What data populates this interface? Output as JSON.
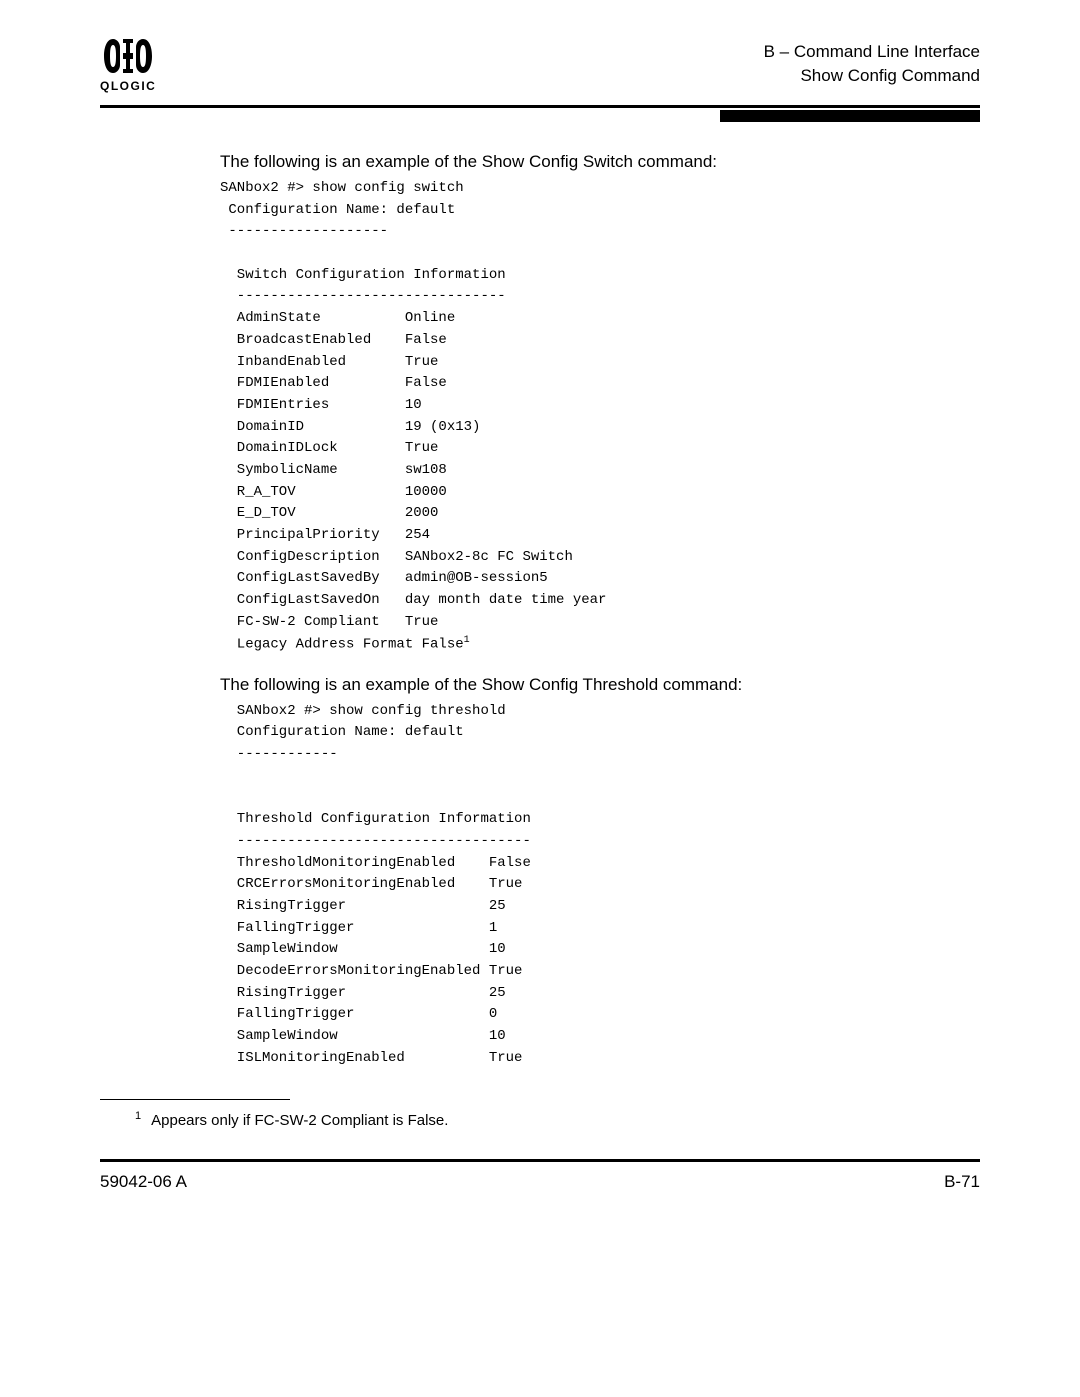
{
  "header": {
    "logoText": "QLOGIC",
    "line1": "B – Command Line Interface",
    "line2": "Show Config Command"
  },
  "section1": {
    "intro": "The following is an example of the Show Config Switch command:",
    "prompt": "SANbox2 #> show config switch",
    "confName": " Configuration Name: default",
    "dash1": " -------------------",
    "title": "  Switch Configuration Information",
    "dash2": "  --------------------------------",
    "rows": [
      {
        "k": "  AdminState          ",
        "v": "Online"
      },
      {
        "k": "  BroadcastEnabled    ",
        "v": "False"
      },
      {
        "k": "  InbandEnabled       ",
        "v": "True"
      },
      {
        "k": "  FDMIEnabled         ",
        "v": "False"
      },
      {
        "k": "  FDMIEntries         ",
        "v": "10"
      },
      {
        "k": "  DomainID            ",
        "v": "19 (0x13)"
      },
      {
        "k": "  DomainIDLock        ",
        "v": "True"
      },
      {
        "k": "  SymbolicName        ",
        "v": "sw108"
      },
      {
        "k": "  R_A_TOV             ",
        "v": "10000"
      },
      {
        "k": "  E_D_TOV             ",
        "v": "2000"
      },
      {
        "k": "  PrincipalPriority   ",
        "v": "254"
      },
      {
        "k": "  ConfigDescription   ",
        "v": "SANbox2-8c FC Switch"
      },
      {
        "k": "  ConfigLastSavedBy   ",
        "v": "admin@OB-session5"
      },
      {
        "k": "  ConfigLastSavedOn   ",
        "v": "day month date time year"
      },
      {
        "k": "  FC-SW-2 Compliant   ",
        "v": "True"
      }
    ],
    "lastRowKey": "  Legacy Address Format ",
    "lastRowVal": "False",
    "lastRowSup": "1"
  },
  "section2": {
    "intro": "The following is an example of the Show Config Threshold command:",
    "prompt": "  SANbox2 #> show config threshold",
    "confName": "  Configuration Name: default",
    "dash1": "  ------------",
    "title": "  Threshold Configuration Information",
    "dash2": "  -----------------------------------",
    "rows": [
      {
        "k": "  ThresholdMonitoringEnabled    ",
        "v": "False"
      },
      {
        "k": "  CRCErrorsMonitoringEnabled    ",
        "v": "True"
      },
      {
        "k": "  RisingTrigger                 ",
        "v": "25"
      },
      {
        "k": "  FallingTrigger                ",
        "v": "1"
      },
      {
        "k": "  SampleWindow                  ",
        "v": "10"
      },
      {
        "k": "  DecodeErrorsMonitoringEnabled ",
        "v": "True"
      },
      {
        "k": "  RisingTrigger                 ",
        "v": "25"
      },
      {
        "k": "  FallingTrigger                ",
        "v": "0"
      },
      {
        "k": "  SampleWindow                  ",
        "v": "10"
      },
      {
        "k": "  ISLMonitoringEnabled          ",
        "v": "True"
      }
    ]
  },
  "footnote": {
    "num": "1",
    "text": "Appears only if FC-SW-2 Compliant is False."
  },
  "footer": {
    "left": "59042-06  A",
    "right": "B-71"
  }
}
